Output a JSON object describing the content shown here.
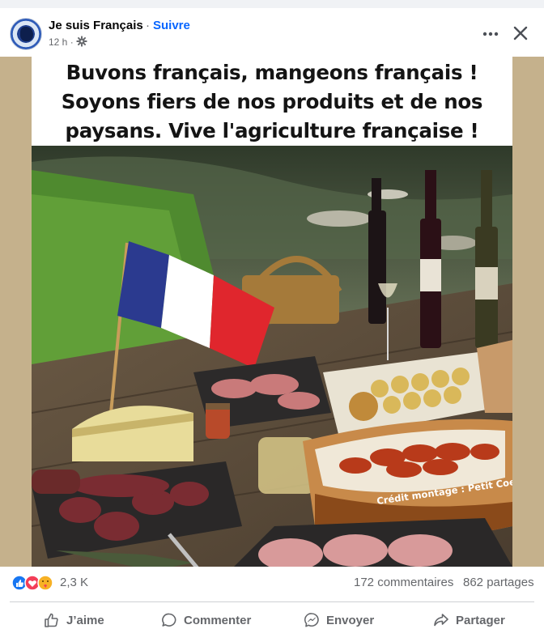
{
  "post": {
    "page_name": "Je suis Français",
    "separator": "·",
    "follow_label": "Suivre",
    "time": "12 h ·",
    "privacy_icon": "gear-icon",
    "more_icon": "more-dots-icon",
    "close_icon": "close-icon"
  },
  "image": {
    "caption_lines": [
      "Buvons français, mangeons français !",
      "Soyons fiers de nos produits et de nos",
      "paysans. Vive l'agriculture française !"
    ],
    "credit": "Crédit montage : Petit Coeur",
    "flag_colors": [
      "#2b3a8f",
      "#ffffff",
      "#e0262d"
    ]
  },
  "stats": {
    "reaction_icons": [
      "like-icon",
      "love-icon",
      "care-icon"
    ],
    "reactions_count": "2,3 K",
    "comments": "172 commentaires",
    "shares": "862 partages"
  },
  "actions": {
    "like": "J’aime",
    "comment": "Commenter",
    "send": "Envoyer",
    "share": "Partager"
  },
  "colors": {
    "accent": "#0866ff",
    "secondary_text": "#65676b",
    "like_blue": "#1877f2",
    "love_red": "#f33e58",
    "care_yellow": "#f7b125"
  }
}
